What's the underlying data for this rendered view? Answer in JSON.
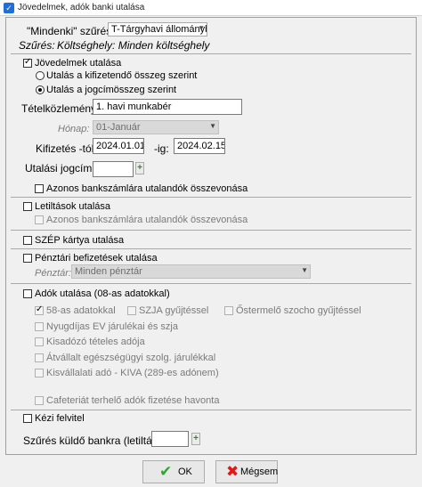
{
  "window": {
    "title": "Jövedelmek, adók banki utalása",
    "icon": "check-window-icon"
  },
  "filter": {
    "label": "\"Mindenki\" szűrés:",
    "value": "T-Tárgyhavi állományba",
    "summary_label": "Szűrés:",
    "summary_value": "Költséghely: Minden költséghely"
  },
  "jovedelmek": {
    "label": "Jövedelmek utalása",
    "checked": true,
    "radio1": "Utalás a kifizetendő összeg szerint",
    "radio2": "Utalás a jogcímösszeg szerint",
    "tetelkozlemeny_label": "Tételközlemény:",
    "tetelkozlemeny_value": "1. havi munkabér",
    "honap_label": "Hónap:",
    "honap_value": "01-Január",
    "kifizetes_label": "Kifizetés -tól:",
    "kifizetes_from": "2024.01.01",
    "ig_label": "-ig:",
    "kifizetes_to": "2024.02.15",
    "utalasi_label": "Utalási jogcím:",
    "utalasi_value": "",
    "azonos_label": "Azonos bankszámlára utalandók összevonása"
  },
  "letiltasok": {
    "label": "Letiltások utalása",
    "azonos_label": "Azonos bankszámlára utalandók összevonása"
  },
  "szep": {
    "label": "SZÉP kártya utalása"
  },
  "penztari": {
    "label": "Pénztári befizetések utalása",
    "penztar_label": "Pénztár:",
    "penztar_value": "Minden pénztár"
  },
  "adok": {
    "label": "Adók utalása (08-as adatokkal)",
    "item_58": "58-as adatokkal",
    "szja": "SZJA gyűjtéssel",
    "ostermelo": "Őstermelő szocho gyűjtéssel",
    "nyugdijas": "Nyugdíjas EV járulékai és szja",
    "kisadozo": "Kisadózó tételes adója",
    "atvallalt": "Átvállalt egészségügyi szolg. járulékkal",
    "kiva": "Kisvállalati adó - KIVA (289-es adónem)",
    "cafeteria": "Cafeteriát terhelő adók fizetése havonta"
  },
  "kezi": {
    "label": "Kézi felvitel"
  },
  "bank_filter": {
    "label": "Szűrés küldő bankra (letiltás):",
    "value": ""
  },
  "buttons": {
    "ok": "OK",
    "cancel": "Mégsem"
  }
}
